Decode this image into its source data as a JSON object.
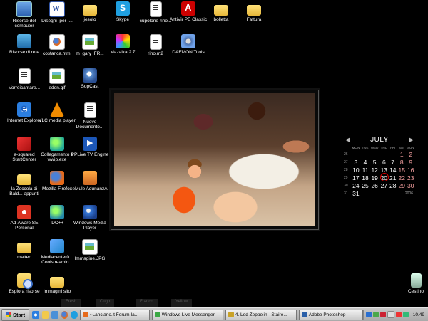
{
  "desktop": {
    "icons": [
      {
        "id": "risorse-computer",
        "label": "Risorse del computer",
        "icon": "computer-icon"
      },
      {
        "id": "disegni",
        "label": "Disegni_per_...",
        "icon": "word-document-icon"
      },
      {
        "id": "jesolo",
        "label": "jesolo",
        "icon": "folder-icon"
      },
      {
        "id": "skype",
        "label": "Skype",
        "icon": "skype-icon"
      },
      {
        "id": "cupolone",
        "label": "cupolone-rino...",
        "icon": "text-document-icon"
      },
      {
        "id": "antivir",
        "label": "AntiVir PE Classic",
        "icon": "avira-icon"
      },
      {
        "id": "bolletta",
        "label": "bolletta",
        "icon": "folder-icon"
      },
      {
        "id": "fattura",
        "label": "Fattura",
        "icon": "folder-icon"
      },
      {
        "id": "risorse-rete",
        "label": "Risorse di rete",
        "icon": "network-icon"
      },
      {
        "id": "costarica",
        "label": "costarica.html",
        "icon": "html-file-icon"
      },
      {
        "id": "m-gary",
        "label": "m_gary_FR...",
        "icon": "image-file-icon"
      },
      {
        "id": "mazaika",
        "label": "Mazaika 2.7",
        "icon": "mazaika-icon"
      },
      {
        "id": "rino",
        "label": "rino.m2",
        "icon": "text-document-icon"
      },
      {
        "id": "daemon",
        "label": "DAEMON Tools",
        "icon": "daemon-tools-icon"
      },
      {
        "id": "vorreicantare",
        "label": "Vorreicantare...",
        "icon": "text-document-icon"
      },
      {
        "id": "eden",
        "label": "eden.gif",
        "icon": "image-file-icon"
      },
      {
        "id": "sopcast",
        "label": "SopCast",
        "icon": "sopcast-icon"
      },
      {
        "id": "ie",
        "label": "Internet Explorer",
        "icon": "internet-explorer-icon"
      },
      {
        "id": "vlc",
        "label": "VLC media player",
        "icon": "vlc-icon"
      },
      {
        "id": "nuovo-doc",
        "label": "Nuovo Documento...",
        "icon": "text-document-icon"
      },
      {
        "id": "asquared",
        "label": "a-squared StartCenter",
        "icon": "a-squared-icon"
      },
      {
        "id": "collegamento",
        "label": "Collegamento a wwip.exe",
        "icon": "shortcut-icon"
      },
      {
        "id": "pplive",
        "label": "PPLive TV Engine",
        "icon": "pplive-icon"
      },
      {
        "id": "zoccola",
        "label": "la Zoccola di Bald... appunti",
        "icon": "folder-icon"
      },
      {
        "id": "firefox",
        "label": "Mozilla Firefox",
        "icon": "firefox-icon"
      },
      {
        "id": "emule",
        "label": "eMule AdunanzA",
        "icon": "emule-icon"
      },
      {
        "id": "adaware",
        "label": "Ad-Aware SE Personal",
        "icon": "ad-aware-icon"
      },
      {
        "id": "idc",
        "label": "iDC++",
        "icon": "idc-icon"
      },
      {
        "id": "wmp",
        "label": "Windows Media Player",
        "icon": "windows-media-player-icon"
      },
      {
        "id": "matteo",
        "label": "matteo",
        "icon": "folder-icon"
      },
      {
        "id": "mediacenter",
        "label": "Mediacenter0... Coolstreamin...",
        "icon": "mediacenter-icon"
      },
      {
        "id": "immagine",
        "label": "Immagine.JPG",
        "icon": "image-file-icon"
      },
      {
        "id": "esplora",
        "label": "Esplora risorse",
        "icon": "explorer-icon"
      },
      {
        "id": "immagini-sito",
        "label": "Immagini sito",
        "icon": "folder-icon"
      },
      {
        "id": "cestino",
        "label": "Cestino",
        "icon": "recycle-bin-icon"
      }
    ],
    "ghost_labels": [
      "Fresh",
      "Cugo",
      "Franco",
      "Yellow"
    ]
  },
  "calendar": {
    "month": "JULY",
    "year": "2006",
    "weekdays": [
      "MON",
      "TUE",
      "WED",
      "THU",
      "FRI",
      "SAT",
      "SUN"
    ],
    "weeks": [
      {
        "wk": "26",
        "days": [
          "",
          "",
          "",
          "",
          "",
          "1",
          "2"
        ]
      },
      {
        "wk": "27",
        "days": [
          "3",
          "4",
          "5",
          "6",
          "7",
          "8",
          "9"
        ]
      },
      {
        "wk": "28",
        "days": [
          "10",
          "11",
          "12",
          "13",
          "14",
          "15",
          "16"
        ]
      },
      {
        "wk": "29",
        "days": [
          "17",
          "18",
          "19",
          "20",
          "21",
          "22",
          "23"
        ]
      },
      {
        "wk": "30",
        "days": [
          "24",
          "25",
          "26",
          "27",
          "28",
          "29",
          "30"
        ]
      },
      {
        "wk": "31",
        "days": [
          "31",
          "",
          "",
          "",
          "",
          "",
          ""
        ]
      }
    ],
    "today": "20"
  },
  "taskbar": {
    "start_label": "Start",
    "tasks": [
      {
        "label": "~Lanciano.it Forum-la...",
        "icon": "firefox-icon"
      },
      {
        "label": "Windows Live Messenger",
        "icon": "messenger-icon"
      },
      {
        "label": "4. Led Zeppelin - Staire...",
        "icon": "winamp-icon"
      },
      {
        "label": "Adobe Photoshop",
        "icon": "photoshop-icon"
      }
    ],
    "clock": "10.49"
  },
  "colors": {
    "desktop_bg": "#000000",
    "calendar_today_ring": "#dd0000",
    "calendar_weekend": "#f6a0a0"
  }
}
